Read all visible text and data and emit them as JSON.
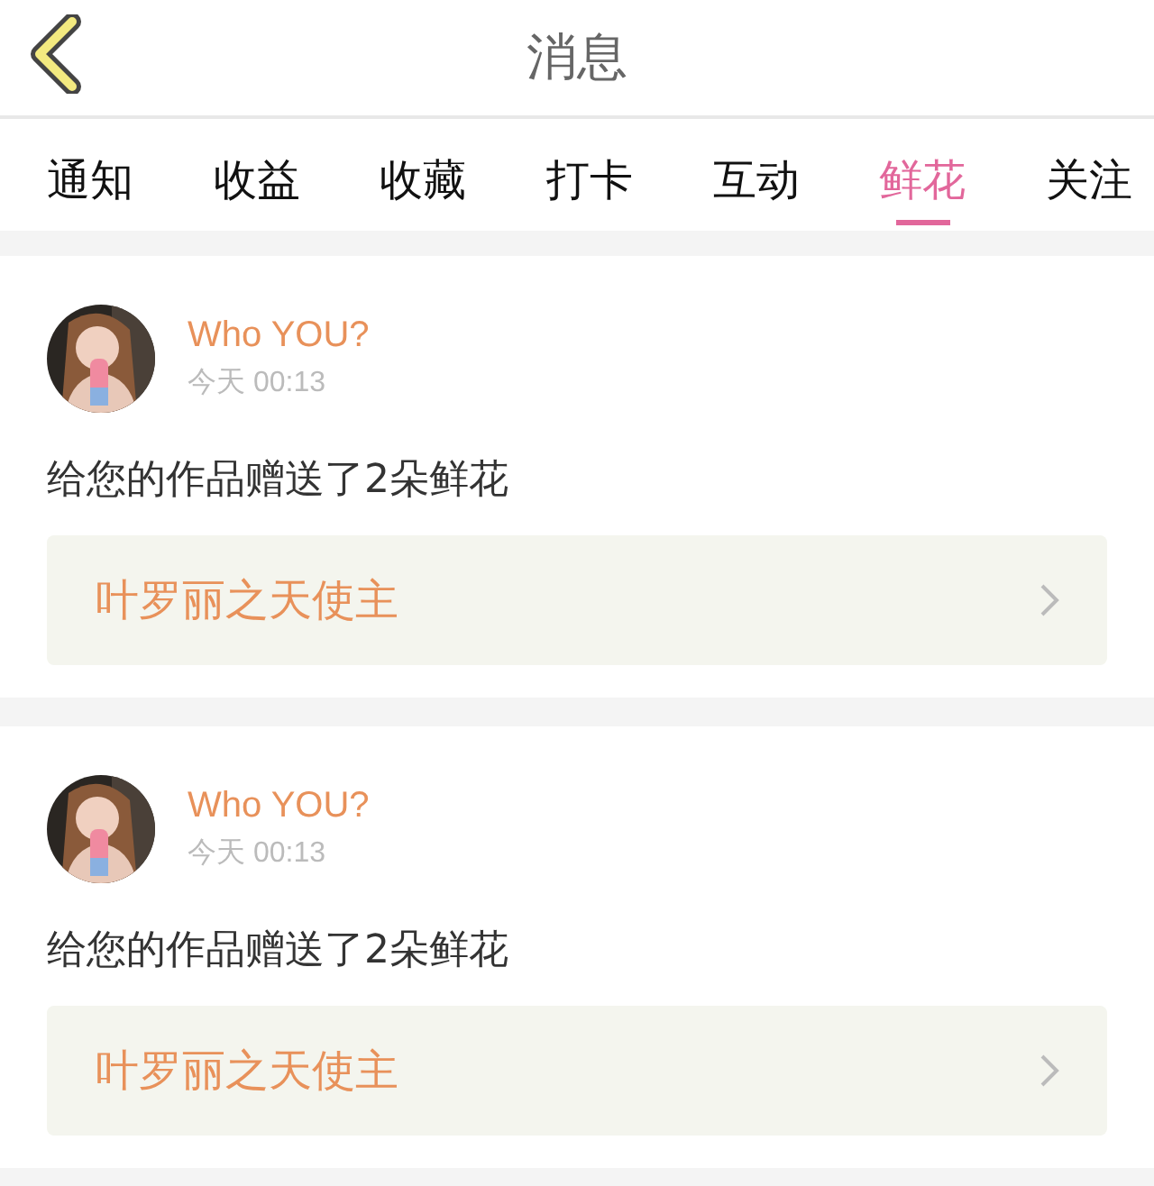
{
  "header": {
    "title": "消息"
  },
  "tabs": [
    {
      "label": "通知",
      "selected": false
    },
    {
      "label": "收益",
      "selected": false
    },
    {
      "label": "收藏",
      "selected": false
    },
    {
      "label": "打卡",
      "selected": false
    },
    {
      "label": "互动",
      "selected": false
    },
    {
      "label": "鲜花",
      "selected": true
    },
    {
      "label": "关注",
      "selected": false
    }
  ],
  "messages": [
    {
      "user": "Who YOU?",
      "time": "今天 00:13",
      "text": "给您的作品赠送了2朵鲜花",
      "work": "叶罗丽之天使主"
    },
    {
      "user": "Who YOU?",
      "time": "今天 00:13",
      "text": "给您的作品赠送了2朵鲜花",
      "work": "叶罗丽之天使主"
    }
  ]
}
